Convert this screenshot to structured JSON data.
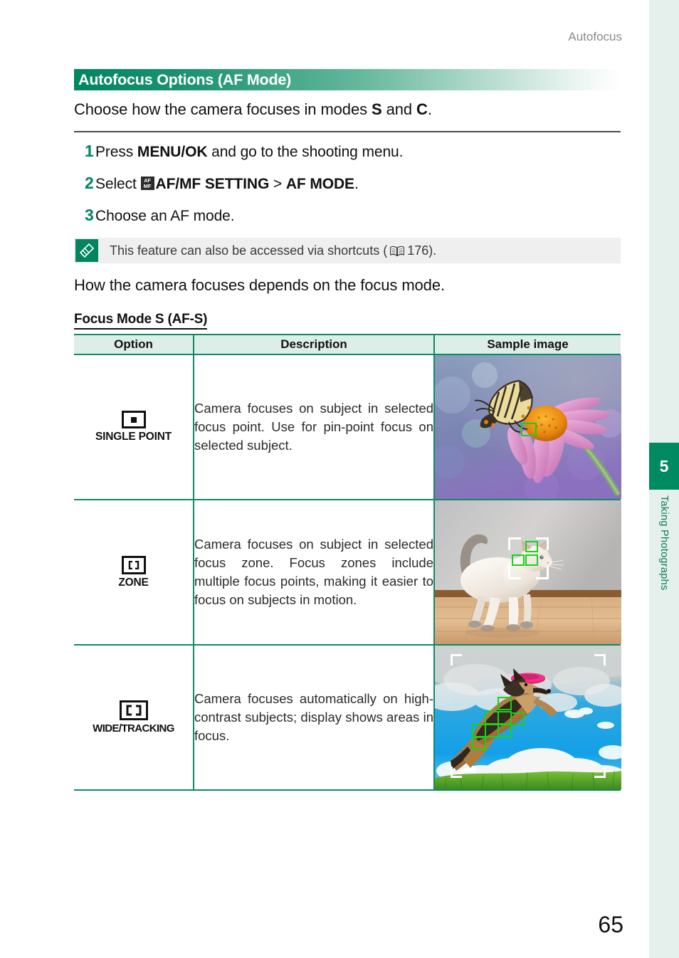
{
  "document": {
    "running_header": "Autofocus",
    "page_number": "65",
    "side_tab": {
      "chapter_number": "5",
      "chapter_label": "Taking Photographs",
      "accent_color": "#008a62",
      "background_color": "#e5f0ec"
    }
  },
  "section": {
    "title": "Autofocus Options (AF Mode)",
    "intro_prefix": "Choose how the camera focuses in modes ",
    "intro_mode_1": "S",
    "intro_conjunction": " and ",
    "intro_mode_2": "C",
    "intro_suffix": "."
  },
  "steps": [
    {
      "number": "1",
      "prefix": "Press ",
      "bold": "MENU/OK",
      "suffix": " and go to the shooting menu.",
      "icon": ""
    },
    {
      "number": "2",
      "prefix": "Select ",
      "icon": "af-mf-setting-icon",
      "icon_top": "AF",
      "icon_bottom": "MF",
      "bold": "AF/MF SETTING",
      "separator": " > ",
      "bold2": "AF MODE",
      "suffix": "."
    },
    {
      "number": "3",
      "prefix": "Choose an AF mode.",
      "bold": "",
      "suffix": ""
    }
  ],
  "tip": {
    "icon": "note-tip-icon",
    "text_before": "This feature can also be accessed via shortcuts (",
    "book_icon": "book-reference-icon",
    "page_reference": "176",
    "text_after": ")."
  },
  "focus_lead": "How the camera focuses depends on the focus mode.",
  "subsection": {
    "heading": "Focus Mode S (AF-S)"
  },
  "table": {
    "headers": {
      "option": "Option",
      "description": "Description",
      "sample": "Sample image"
    },
    "rows": [
      {
        "icon_name": "single-point-af-icon",
        "label": "SINGLE POINT",
        "description": "Camera focuses on subject in selected focus point. Use for pin-point focus on selected subject.",
        "sample_image_alt": "butterfly-on-coneflower-sample",
        "af_points": 1
      },
      {
        "icon_name": "zone-af-icon",
        "label": "ZONE",
        "description": "Camera focuses on subject in selected focus zone. Focus zones include multiple focus points, making it easier to focus on subjects in motion.",
        "sample_image_alt": "walking-cat-sample",
        "af_points": 3
      },
      {
        "icon_name": "wide-tracking-af-icon",
        "label": "WIDE/TRACKING",
        "description": "Camera focuses automatically on high-contrast subjects; display shows areas in focus.",
        "sample_image_alt": "dog-catching-frisbee-sample",
        "af_points": 8
      }
    ]
  },
  "colors": {
    "brand_green": "#00855f",
    "table_border": "#0d8a66",
    "table_header_bg": "#ddeee8",
    "af_box_green": "#19d219",
    "tip_bg": "#efefef"
  }
}
